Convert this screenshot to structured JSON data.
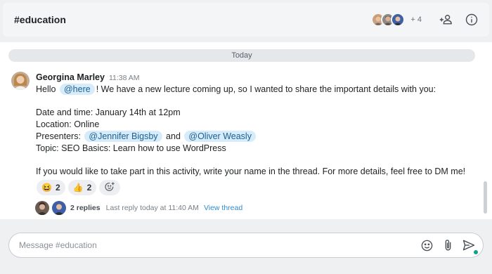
{
  "header": {
    "channel_title": "#education",
    "member_extra": "+ 4",
    "member_avatars": [
      "avatar-1",
      "avatar-2",
      "avatar-3"
    ]
  },
  "feed": {
    "date_divider": "Today",
    "message": {
      "author": "Georgina Marley",
      "time": "11:38 AM",
      "greeting": "Hello",
      "mention_here": "@here",
      "intro_rest": "! We have a new lecture coming up, so I wanted to share the important details with you:",
      "date_line": "Date and time: January 14th at 12pm",
      "location_line": "Location: Online",
      "presenters_label": "Presenters:",
      "presenter_1": "@Jennifer Bigsby",
      "presenters_and": "and",
      "presenter_2": "@Oliver Weasly",
      "topic_line": "Topic: SEO Basics: Learn how to use WordPress",
      "closing": "If you would like to take part in this activity, write your name in the thread. For more details, feel free to DM me!",
      "reactions": [
        {
          "emoji": "😆",
          "count": "2"
        },
        {
          "emoji": "👍",
          "count": "2"
        }
      ],
      "thread": {
        "replies": "2 replies",
        "last_reply": "Last reply today at 11:40 AM",
        "view_thread": "View thread"
      }
    }
  },
  "composer": {
    "placeholder": "Message #education"
  },
  "colors": {
    "mention_bg": "#d7ecfb",
    "mention_text": "#1d5f8f",
    "link": "#2f8bd0",
    "status_dot": "#139f8d"
  }
}
